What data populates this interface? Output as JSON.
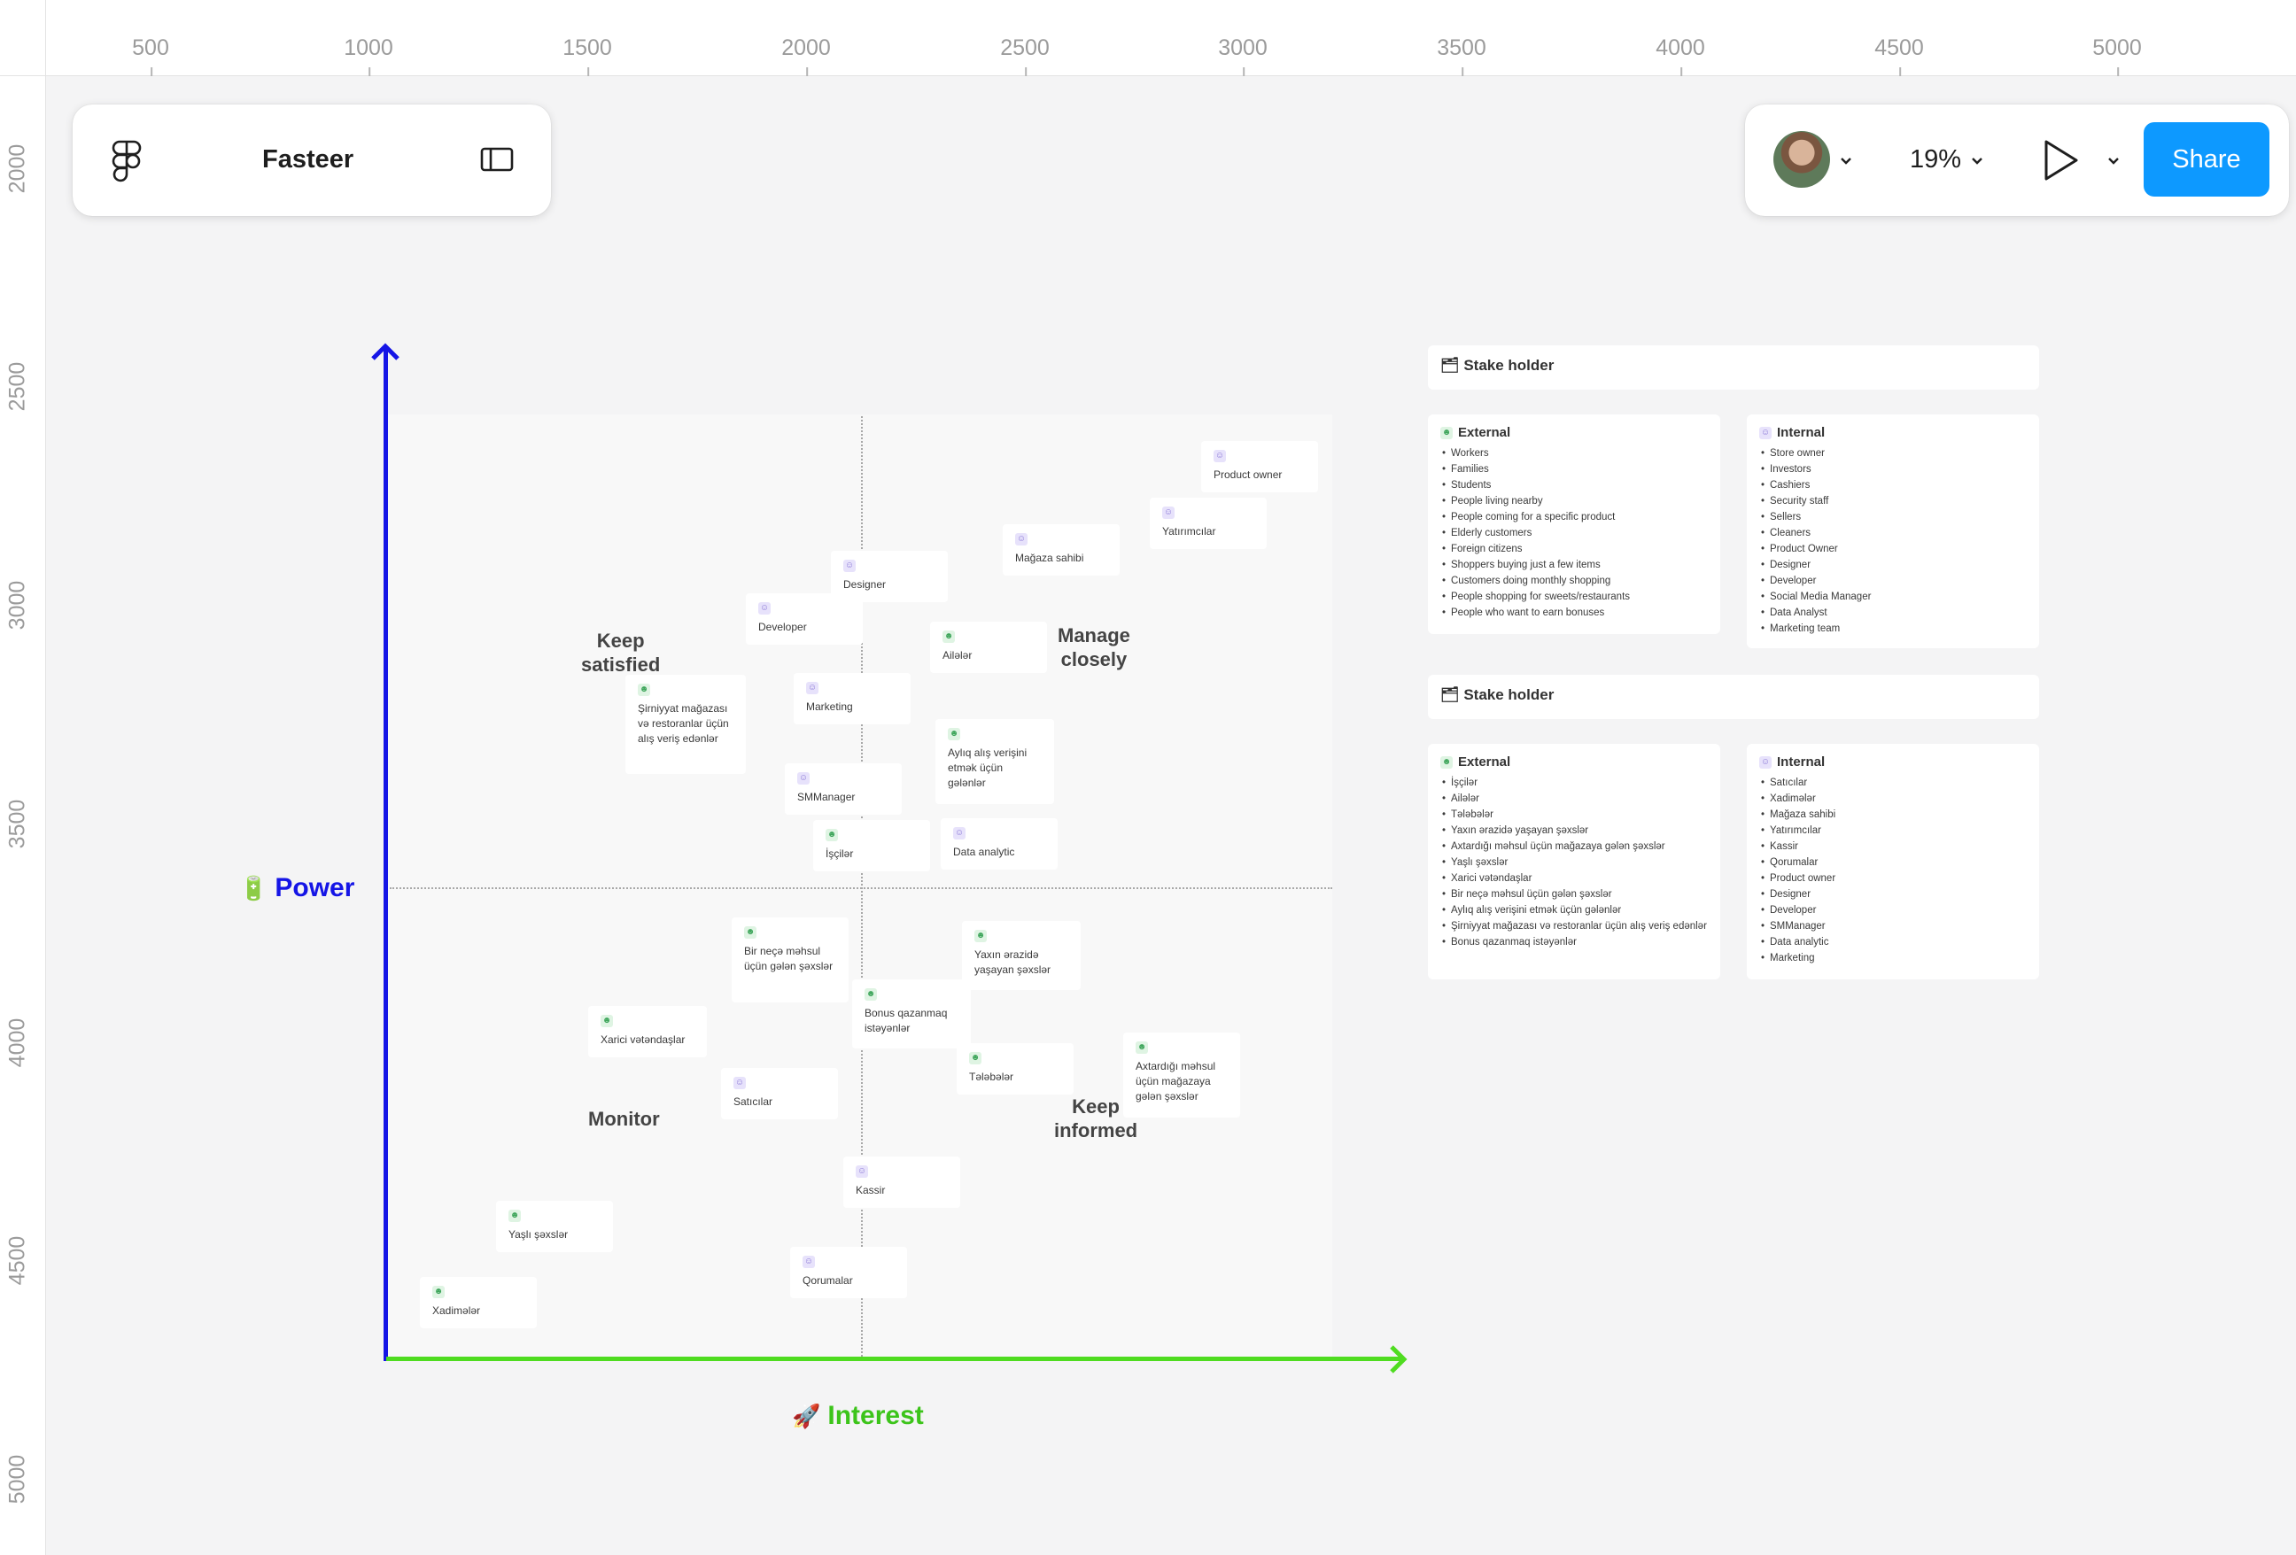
{
  "ruler": {
    "top_ticks": [
      "500",
      "1000",
      "1500",
      "2000",
      "2500",
      "3000",
      "3500",
      "4000",
      "4500",
      "5000"
    ],
    "left_ticks": [
      "2000",
      "2500",
      "3000",
      "3500",
      "4000",
      "4500",
      "5000"
    ]
  },
  "toolbar_left": {
    "file_name": "Fasteer"
  },
  "toolbar_right": {
    "zoom_label": "19%",
    "share_label": "Share"
  },
  "matrix": {
    "y_axis_label": "Power",
    "y_axis_emoji": "🔋",
    "x_axis_label": "Interest",
    "x_axis_emoji": "🚀",
    "quadrants": {
      "keep_satisfied": [
        "Keep",
        "satisfied"
      ],
      "manage_closely": [
        "Manage",
        "closely"
      ],
      "monitor": [
        "Monitor"
      ],
      "keep_informed": [
        "Keep",
        "informed"
      ]
    },
    "notes": [
      {
        "text": "Product owner",
        "kind": "internal"
      },
      {
        "text": "Yatırımcılar",
        "kind": "internal"
      },
      {
        "text": "Mağaza sahibi",
        "kind": "internal"
      },
      {
        "text": "Designer",
        "kind": "internal"
      },
      {
        "text": "Developer",
        "kind": "internal"
      },
      {
        "text": "Ailələr",
        "kind": "external"
      },
      {
        "text": "Marketing",
        "kind": "internal"
      },
      {
        "text": "Şirniyyat mağazası və restoranlar üçün alış veriş edənlər",
        "kind": "external"
      },
      {
        "text": "Aylıq alış verişini etmək üçün gələnlər",
        "kind": "external"
      },
      {
        "text": "SMManager",
        "kind": "internal"
      },
      {
        "text": "İşçilər",
        "kind": "external"
      },
      {
        "text": "Data analytic",
        "kind": "internal"
      },
      {
        "text": "Bir neçə məhsul üçün gələn şəxslər",
        "kind": "external"
      },
      {
        "text": "Yaxın ərazidə yaşayan şəxslər",
        "kind": "external"
      },
      {
        "text": "Bonus qazanmaq istəyənlər",
        "kind": "external"
      },
      {
        "text": "Xarici vətəndaşlar",
        "kind": "external"
      },
      {
        "text": "Tələbələr",
        "kind": "external"
      },
      {
        "text": "Axtardığı məhsul üçün mağazaya gələn şəxslər",
        "kind": "external"
      },
      {
        "text": "Satıcılar",
        "kind": "internal"
      },
      {
        "text": "Kassir",
        "kind": "internal"
      },
      {
        "text": "Yaşlı şəxslər",
        "kind": "external"
      },
      {
        "text": "Qorumalar",
        "kind": "internal"
      },
      {
        "text": "Xadimələr",
        "kind": "external"
      }
    ]
  },
  "stakeholders_en": {
    "title": "Stake holder",
    "external_title": "External",
    "external": [
      "Workers",
      "Families",
      "Students",
      "People living nearby",
      "People coming for a specific product",
      "Elderly customers",
      "Foreign citizens",
      "Shoppers buying just a few items",
      "Customers doing monthly shopping",
      "People shopping for sweets/restaurants",
      "People who want to earn bonuses"
    ],
    "internal_title": "Internal",
    "internal": [
      "Store owner",
      "Investors",
      "Cashiers",
      "Security staff",
      "Sellers",
      "Cleaners",
      "Product Owner",
      "Designer",
      "Developer",
      "Social Media Manager",
      "Data Analyst",
      "Marketing team"
    ]
  },
  "stakeholders_az": {
    "title": "Stake holder",
    "external_title": "External",
    "external": [
      "İşçilər",
      "Ailələr",
      "Tələbələr",
      "Yaxın ərazidə yaşayan şəxslər",
      "Axtardığı məhsul üçün mağazaya gələn şəxslər",
      "Yaşlı şəxslər",
      "Xarici vətəndaşlar",
      "Bir neçə məhsul üçün gələn şəxslər",
      "Aylıq alış verişini etmək üçün gələnlər",
      "Şirniyyat mağazası və restoranlar üçün alış veriş edənlər",
      "Bonus qazanmaq istəyənlər"
    ],
    "internal_title": "Internal",
    "internal": [
      "Satıcılar",
      "Xadimələr",
      "Mağaza sahibi",
      "Yatırımcılar",
      "Kassir",
      "Qorumalar",
      "Product owner",
      "Designer",
      "Developer",
      "SMManager",
      "Data analytic",
      "Marketing"
    ]
  },
  "colors": {
    "power_axis": "#1515e6",
    "interest_axis": "#4fdc20",
    "share_button": "#0d99ff",
    "internal_icon": "#8b78d6",
    "external_icon": "#3da55a"
  },
  "icons": [
    "figma-logo-icon",
    "sidebar-toggle-icon",
    "chevron-down-icon",
    "play-icon",
    "person-icon",
    "group-icon",
    "folder-icon"
  ]
}
